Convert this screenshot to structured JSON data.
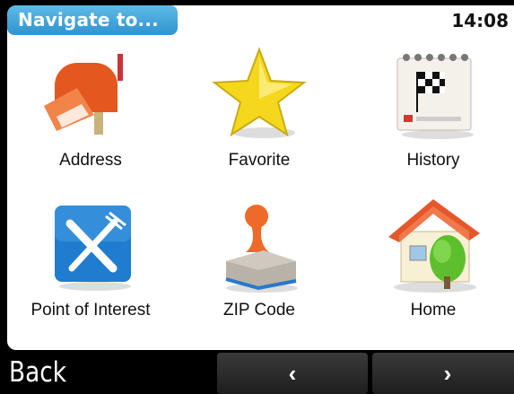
{
  "header": {
    "title": "Navigate to...",
    "time": "14:08"
  },
  "menu": {
    "items": [
      {
        "label": "Address",
        "icon": "mailbox-icon"
      },
      {
        "label": "Favorite",
        "icon": "star-icon"
      },
      {
        "label": "History",
        "icon": "calendar-flag-icon"
      },
      {
        "label": "Point of Interest",
        "icon": "fork-knife-icon"
      },
      {
        "label": "ZIP Code",
        "icon": "stamp-icon"
      },
      {
        "label": "Home",
        "icon": "house-icon"
      }
    ]
  },
  "footer": {
    "back_label": "Back",
    "prev_label": "‹",
    "next_label": "›"
  },
  "colors": {
    "title_bg": "#2f93cf",
    "poi_blue": "#1f7ccf",
    "address_orange": "#e4571f"
  }
}
